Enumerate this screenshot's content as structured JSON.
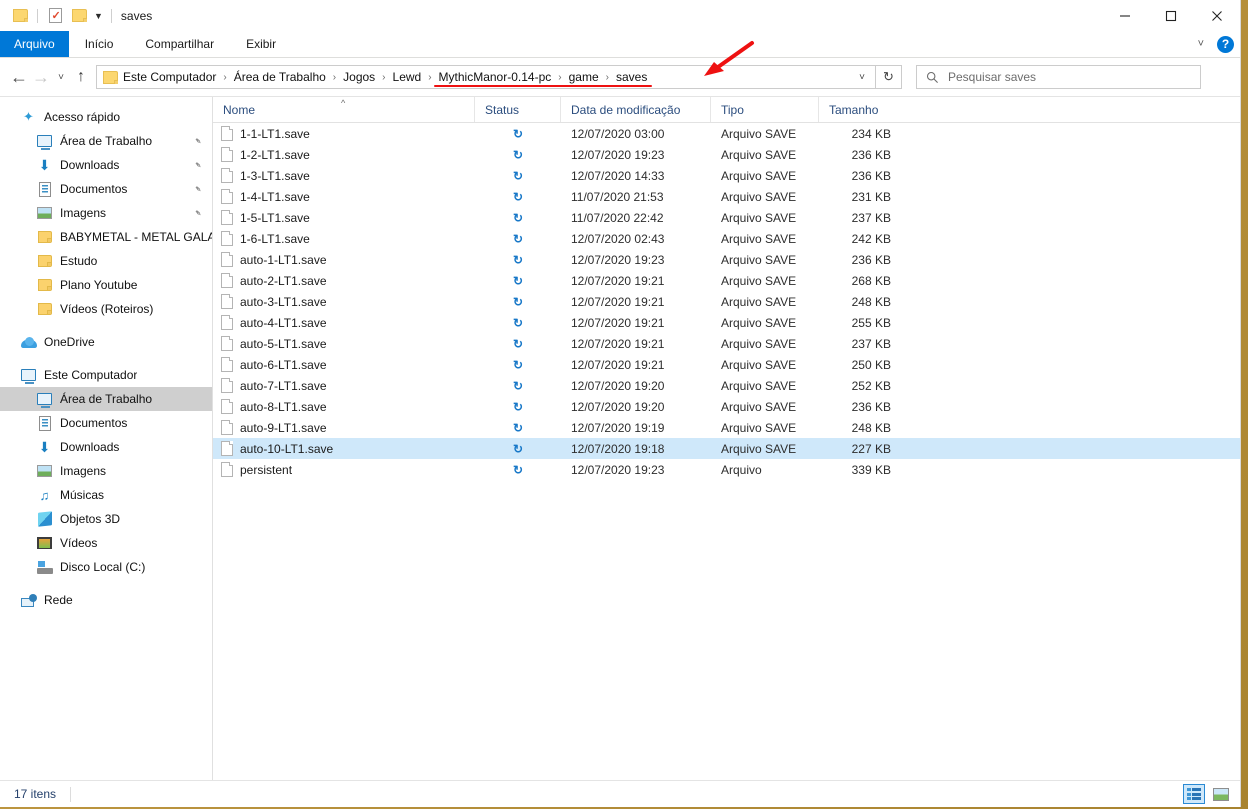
{
  "window": {
    "title": "saves",
    "quick_access_toolbar": [
      {
        "name": "folder-properties",
        "icon": "folder-icon"
      },
      {
        "name": "properties",
        "icon": "document-check-icon"
      },
      {
        "name": "new-folder",
        "icon": "folder-icon"
      },
      {
        "name": "customize",
        "icon": "chevron-down-icon"
      }
    ],
    "controls": {
      "minimize": "minimize-icon",
      "maximize": "maximize-icon",
      "close": "close-icon"
    }
  },
  "ribbon": {
    "tabs": [
      {
        "label": "Arquivo",
        "active": true
      },
      {
        "label": "Início",
        "active": false
      },
      {
        "label": "Compartilhar",
        "active": false
      },
      {
        "label": "Exibir",
        "active": false
      }
    ],
    "expand_icon": "chevron-down-icon",
    "help_label": "?"
  },
  "navigation": {
    "back_icon": "arrow-left-icon",
    "forward_icon": "arrow-right-icon",
    "recent_icon": "chevron-down-icon",
    "up_icon": "arrow-up-icon",
    "refresh_icon": "refresh-icon",
    "dropdown_icon": "chevron-down-icon",
    "breadcrumbs": [
      "Este Computador",
      "Área de Trabalho",
      "Jogos",
      "Lewd",
      "MythicManor-0.14-pc",
      "game",
      "saves"
    ],
    "separator": "›"
  },
  "search": {
    "placeholder": "Pesquisar saves",
    "icon": "search-icon"
  },
  "annotations": {
    "underline_color": "#ee1111",
    "arrow_color": "#ee1111",
    "underlined_breadcrumbs": [
      "MythicManor-0.14-pc",
      "game",
      "saves"
    ]
  },
  "sidebar": {
    "items": [
      {
        "label": "Acesso rápido",
        "icon": "star-pin-icon",
        "level": 1,
        "pinned": false,
        "selected": false
      },
      {
        "label": "Área de Trabalho",
        "icon": "desktop-icon",
        "level": 2,
        "pinned": true,
        "selected": false
      },
      {
        "label": "Downloads",
        "icon": "download-icon",
        "level": 2,
        "pinned": true,
        "selected": false
      },
      {
        "label": "Documentos",
        "icon": "documents-icon",
        "level": 2,
        "pinned": true,
        "selected": false
      },
      {
        "label": "Imagens",
        "icon": "pictures-icon",
        "level": 2,
        "pinned": true,
        "selected": false
      },
      {
        "label": "BABYMETAL - METAL GALAXY",
        "icon": "folder-icon",
        "level": 2,
        "pinned": false,
        "selected": false
      },
      {
        "label": "Estudo",
        "icon": "folder-icon",
        "level": 2,
        "pinned": false,
        "selected": false
      },
      {
        "label": "Plano Youtube",
        "icon": "folder-icon",
        "level": 2,
        "pinned": false,
        "selected": false
      },
      {
        "label": "Vídeos (Roteiros)",
        "icon": "folder-icon",
        "level": 2,
        "pinned": false,
        "selected": false
      },
      {
        "label": "OneDrive",
        "icon": "cloud-icon",
        "level": 1,
        "pinned": false,
        "selected": false
      },
      {
        "label": "Este Computador",
        "icon": "computer-icon",
        "level": 1,
        "pinned": false,
        "selected": false
      },
      {
        "label": "Área de Trabalho",
        "icon": "desktop-icon",
        "level": 2,
        "pinned": false,
        "selected": true
      },
      {
        "label": "Documentos",
        "icon": "documents-icon",
        "level": 2,
        "pinned": false,
        "selected": false
      },
      {
        "label": "Downloads",
        "icon": "download-icon",
        "level": 2,
        "pinned": false,
        "selected": false
      },
      {
        "label": "Imagens",
        "icon": "pictures-icon",
        "level": 2,
        "pinned": false,
        "selected": false
      },
      {
        "label": "Músicas",
        "icon": "music-icon",
        "level": 2,
        "pinned": false,
        "selected": false
      },
      {
        "label": "Objetos 3D",
        "icon": "3d-objects-icon",
        "level": 2,
        "pinned": false,
        "selected": false
      },
      {
        "label": "Vídeos",
        "icon": "videos-icon",
        "level": 2,
        "pinned": false,
        "selected": false
      },
      {
        "label": "Disco Local (C:)",
        "icon": "disk-icon",
        "level": 2,
        "pinned": false,
        "selected": false
      },
      {
        "label": "Rede",
        "icon": "network-icon",
        "level": 1,
        "pinned": false,
        "selected": false
      }
    ]
  },
  "file_list": {
    "columns": [
      {
        "label": "Nome",
        "sorted": "asc"
      },
      {
        "label": "Status",
        "sorted": null
      },
      {
        "label": "Data de modificação",
        "sorted": null
      },
      {
        "label": "Tipo",
        "sorted": null
      },
      {
        "label": "Tamanho",
        "sorted": null
      }
    ],
    "sort_icon": "chevron-up-icon",
    "status_icon": "sync-icon",
    "rows": [
      {
        "name": "1-1-LT1.save",
        "status": "sync-icon",
        "date": "12/07/2020 03:00",
        "type": "Arquivo SAVE",
        "size": "234 KB",
        "selected": false
      },
      {
        "name": "1-2-LT1.save",
        "status": "sync-icon",
        "date": "12/07/2020 19:23",
        "type": "Arquivo SAVE",
        "size": "236 KB",
        "selected": false
      },
      {
        "name": "1-3-LT1.save",
        "status": "sync-icon",
        "date": "12/07/2020 14:33",
        "type": "Arquivo SAVE",
        "size": "236 KB",
        "selected": false
      },
      {
        "name": "1-4-LT1.save",
        "status": "sync-icon",
        "date": "11/07/2020 21:53",
        "type": "Arquivo SAVE",
        "size": "231 KB",
        "selected": false
      },
      {
        "name": "1-5-LT1.save",
        "status": "sync-icon",
        "date": "11/07/2020 22:42",
        "type": "Arquivo SAVE",
        "size": "237 KB",
        "selected": false
      },
      {
        "name": "1-6-LT1.save",
        "status": "sync-icon",
        "date": "12/07/2020 02:43",
        "type": "Arquivo SAVE",
        "size": "242 KB",
        "selected": false
      },
      {
        "name": "auto-1-LT1.save",
        "status": "sync-icon",
        "date": "12/07/2020 19:23",
        "type": "Arquivo SAVE",
        "size": "236 KB",
        "selected": false
      },
      {
        "name": "auto-2-LT1.save",
        "status": "sync-icon",
        "date": "12/07/2020 19:21",
        "type": "Arquivo SAVE",
        "size": "268 KB",
        "selected": false
      },
      {
        "name": "auto-3-LT1.save",
        "status": "sync-icon",
        "date": "12/07/2020 19:21",
        "type": "Arquivo SAVE",
        "size": "248 KB",
        "selected": false
      },
      {
        "name": "auto-4-LT1.save",
        "status": "sync-icon",
        "date": "12/07/2020 19:21",
        "type": "Arquivo SAVE",
        "size": "255 KB",
        "selected": false
      },
      {
        "name": "auto-5-LT1.save",
        "status": "sync-icon",
        "date": "12/07/2020 19:21",
        "type": "Arquivo SAVE",
        "size": "237 KB",
        "selected": false
      },
      {
        "name": "auto-6-LT1.save",
        "status": "sync-icon",
        "date": "12/07/2020 19:21",
        "type": "Arquivo SAVE",
        "size": "250 KB",
        "selected": false
      },
      {
        "name": "auto-7-LT1.save",
        "status": "sync-icon",
        "date": "12/07/2020 19:20",
        "type": "Arquivo SAVE",
        "size": "252 KB",
        "selected": false
      },
      {
        "name": "auto-8-LT1.save",
        "status": "sync-icon",
        "date": "12/07/2020 19:20",
        "type": "Arquivo SAVE",
        "size": "236 KB",
        "selected": false
      },
      {
        "name": "auto-9-LT1.save",
        "status": "sync-icon",
        "date": "12/07/2020 19:19",
        "type": "Arquivo SAVE",
        "size": "248 KB",
        "selected": false
      },
      {
        "name": "auto-10-LT1.save",
        "status": "sync-icon",
        "date": "12/07/2020 19:18",
        "type": "Arquivo SAVE",
        "size": "227 KB",
        "selected": true
      },
      {
        "name": "persistent",
        "status": "sync-icon",
        "date": "12/07/2020 19:23",
        "type": "Arquivo",
        "size": "339 KB",
        "selected": false
      }
    ]
  },
  "status_bar": {
    "item_count": "17 itens",
    "view_buttons": [
      {
        "name": "details-view",
        "icon": "details-view-icon",
        "active": true
      },
      {
        "name": "large-icons-view",
        "icon": "thumbnail-view-icon",
        "active": false
      }
    ]
  }
}
